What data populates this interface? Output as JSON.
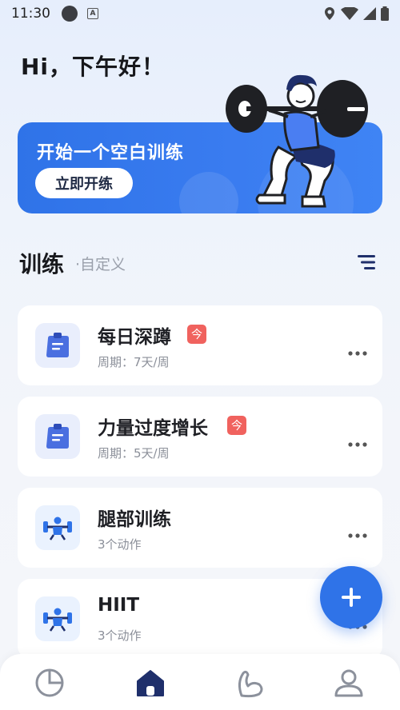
{
  "status_bar": {
    "time": "11:30"
  },
  "greeting": "Hi，下午好！",
  "banner": {
    "title": "开始一个空白训练",
    "button": "立即开练"
  },
  "section": {
    "title": "训练",
    "subtitle": "·自定义"
  },
  "workouts": [
    {
      "name": "每日深蹲",
      "badge": "今",
      "meta": "周期：7天/周",
      "icon": "clipboard-icon"
    },
    {
      "name": "力量过度增长",
      "badge": "今",
      "meta": "周期：5天/周",
      "icon": "clipboard-icon"
    },
    {
      "name": "腿部训练",
      "badge": "",
      "meta": "3个动作",
      "icon": "weightlifter-icon"
    },
    {
      "name": "HIIT",
      "badge": "",
      "meta": "3个动作",
      "icon": "weightlifter-icon"
    }
  ],
  "nav": [
    "stats-icon",
    "home-icon",
    "muscle-icon",
    "profile-icon"
  ],
  "colors": {
    "accent": "#2f73e8",
    "badge": "#f0625e"
  }
}
